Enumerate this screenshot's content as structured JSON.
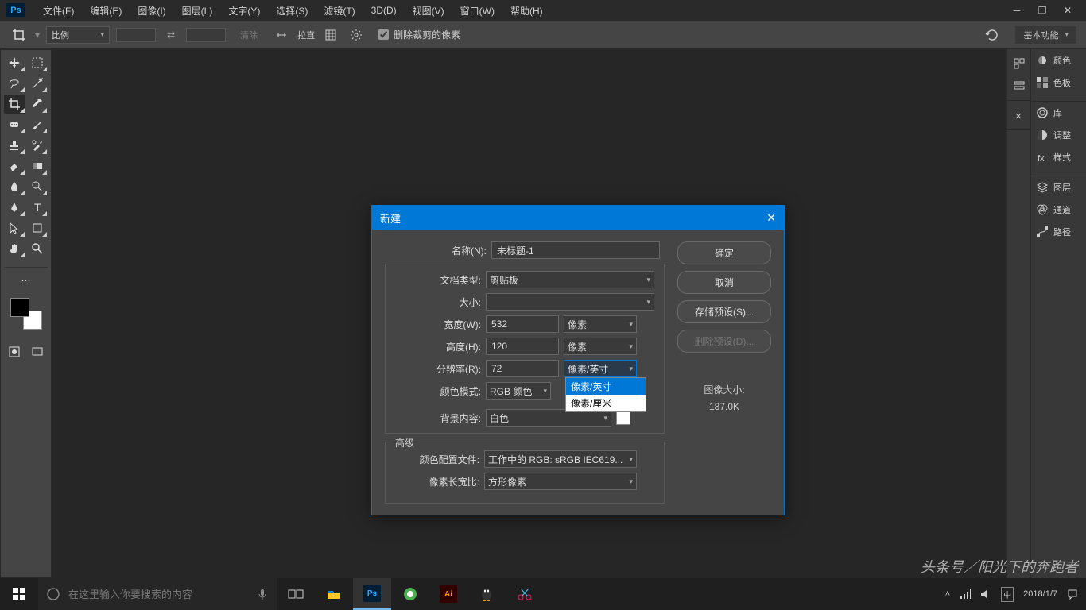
{
  "menubar": {
    "logo": "Ps",
    "items": [
      "文件(F)",
      "编辑(E)",
      "图像(I)",
      "图层(L)",
      "文字(Y)",
      "选择(S)",
      "滤镜(T)",
      "3D(D)",
      "视图(V)",
      "窗口(W)",
      "帮助(H)"
    ]
  },
  "optionsbar": {
    "ratio_label": "比例",
    "clear_label": "清除",
    "straighten_label": "拉直",
    "delete_cropped": "删除裁剪的像素",
    "workspace": "基本功能"
  },
  "right_panels": {
    "items": [
      "颜色",
      "色板",
      "库",
      "调整",
      "样式",
      "图层",
      "通道",
      "路径"
    ]
  },
  "dialog": {
    "title": "新建",
    "name_label": "名称(N):",
    "name_value": "未标题-1",
    "preset_label": "文档类型:",
    "preset_value": "剪贴板",
    "size_label": "大小:",
    "width_label": "宽度(W):",
    "width_value": "532",
    "height_label": "高度(H):",
    "height_value": "120",
    "unit_px": "像素",
    "res_label": "分辨率(R):",
    "res_value": "72",
    "res_unit": "像素/英寸",
    "res_options": [
      "像素/英寸",
      "像素/厘米"
    ],
    "mode_label": "颜色模式:",
    "mode_value": "RGB 颜色",
    "bg_label": "背景内容:",
    "bg_value": "白色",
    "advanced": "高级",
    "profile_label": "颜色配置文件:",
    "profile_value": "工作中的 RGB: sRGB IEC619...",
    "aspect_label": "像素长宽比:",
    "aspect_value": "方形像素",
    "btn_ok": "确定",
    "btn_cancel": "取消",
    "btn_save": "存储预设(S)...",
    "btn_delete": "删除预设(D)...",
    "size_info_label": "图像大小:",
    "size_info_value": "187.0K"
  },
  "taskbar": {
    "search_placeholder": "在这里输入你要搜索的内容",
    "date": "2018/1/7"
  },
  "watermark": "头条号／阳光下的奔跑者"
}
